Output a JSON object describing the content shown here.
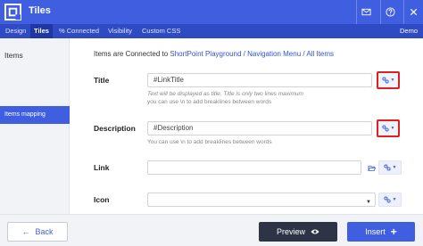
{
  "header": {
    "title": "Tiles",
    "icons": [
      "mail-icon",
      "help-icon",
      "close-icon"
    ]
  },
  "tabs": [
    {
      "label": "Design",
      "active": false
    },
    {
      "label": "Tiles",
      "active": true
    },
    {
      "label": "% Connected",
      "active": false
    },
    {
      "label": "Visibility",
      "active": false
    },
    {
      "label": "Custom CSS",
      "active": false
    }
  ],
  "demo_label": "Demo",
  "sidebar": {
    "title": "Items",
    "active_item": "Items mapping"
  },
  "main": {
    "connected_prefix": "Items are Connected to ",
    "connected_path": "ShortPoint Playground / Navigation Menu / All Items",
    "fields": {
      "title": {
        "label": "Title",
        "value": "#LinkTitle",
        "help_line1": "Text will be displayed as title. Title is only two lines maximum",
        "help_line2": "you can use \\n to add breaklines between words"
      },
      "description": {
        "label": "Description",
        "value": "#Description",
        "help": "You can use \\n to add breaklines between words"
      },
      "link": {
        "label": "Link",
        "value": ""
      },
      "icon": {
        "label": "Icon",
        "value": ""
      }
    }
  },
  "footer": {
    "back_label": "Back",
    "preview_label": "Preview",
    "insert_label": "Insert"
  },
  "colors": {
    "accent": "#3f5fe0",
    "tab_bar": "#2f4bc4",
    "highlight_border": "#e02020",
    "dark_button": "#2d3446"
  }
}
